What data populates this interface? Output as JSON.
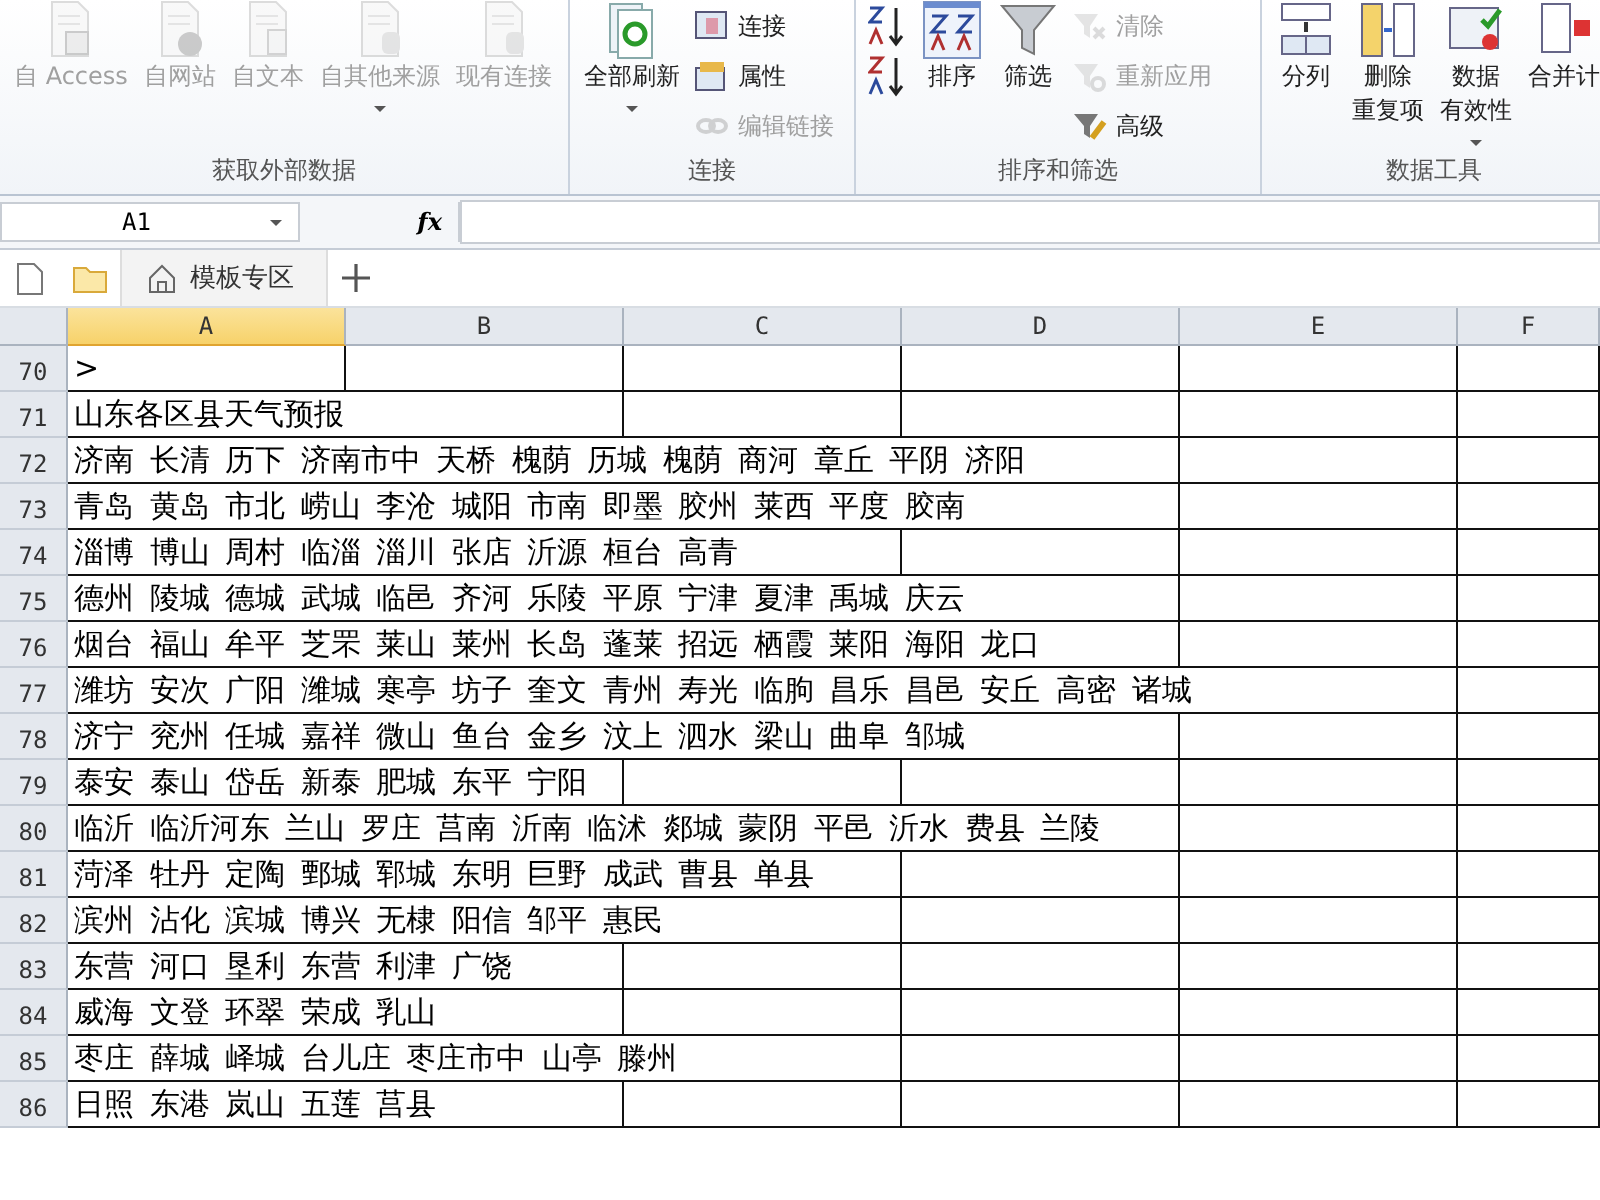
{
  "ribbon": {
    "groups": [
      {
        "label": "获取外部数据",
        "buttons": [
          {
            "lines": [
              "自 Access"
            ],
            "kind": "large",
            "disabled": true,
            "caret": false
          },
          {
            "lines": [
              "自网站"
            ],
            "kind": "large",
            "disabled": true,
            "caret": false
          },
          {
            "lines": [
              "自文本"
            ],
            "kind": "large",
            "disabled": true,
            "caret": false
          },
          {
            "lines": [
              "自其他来源"
            ],
            "kind": "large",
            "disabled": true,
            "caret": true
          },
          {
            "lines": [
              "现有连接"
            ],
            "kind": "large",
            "disabled": true,
            "caret": false
          }
        ]
      },
      {
        "label": "连接",
        "buttons": [
          {
            "lines": [
              "全部刷新"
            ],
            "kind": "large",
            "disabled": false,
            "caret": true
          },
          {
            "lines": [
              "连接"
            ],
            "kind": "small",
            "disabled": false,
            "caret": false
          },
          {
            "lines": [
              "属性"
            ],
            "kind": "small",
            "disabled": false,
            "caret": false
          },
          {
            "lines": [
              "编辑链接"
            ],
            "kind": "small",
            "disabled": true,
            "caret": false
          }
        ]
      },
      {
        "label": "排序和筛选",
        "buttons": [
          {
            "kind": "icon",
            "disabled": false,
            "caret": false
          },
          {
            "kind": "icon",
            "disabled": false,
            "caret": false
          },
          {
            "lines": [
              "排序"
            ],
            "kind": "large",
            "disabled": false,
            "caret": false
          },
          {
            "lines": [
              "筛选"
            ],
            "kind": "large",
            "disabled": false,
            "caret": false
          },
          {
            "lines": [
              "清除"
            ],
            "kind": "small",
            "disabled": true,
            "caret": false
          },
          {
            "lines": [
              "重新应用"
            ],
            "kind": "small",
            "disabled": true,
            "caret": false
          },
          {
            "lines": [
              "高级"
            ],
            "kind": "small",
            "disabled": false,
            "caret": false
          }
        ]
      },
      {
        "label": "数据工具",
        "buttons": [
          {
            "lines": [
              "分列"
            ],
            "kind": "large",
            "disabled": false,
            "caret": false
          },
          {
            "lines": [
              "删除",
              "重复项"
            ],
            "kind": "large",
            "disabled": false,
            "caret": false
          },
          {
            "lines": [
              "数据",
              "有效性"
            ],
            "kind": "large",
            "disabled": false,
            "caret": true
          },
          {
            "lines": [
              "合并计"
            ],
            "kind": "large",
            "disabled": false,
            "caret": false
          }
        ]
      }
    ]
  },
  "name_box": "A1",
  "formula_label": "fx",
  "tabs": [
    {
      "label": "模板专区",
      "selected": true
    }
  ],
  "columns": [
    {
      "label": "A",
      "selected": true
    },
    {
      "label": "B",
      "selected": false
    },
    {
      "label": "C",
      "selected": false
    },
    {
      "label": "D",
      "selected": false
    },
    {
      "label": "E",
      "selected": false
    },
    {
      "label": "F",
      "selected": false
    }
  ],
  "rows": [
    {
      "number": "70",
      "text": ">"
    },
    {
      "number": "71",
      "text": "山东各区县天气预报"
    },
    {
      "number": "72",
      "text": "济南 长清 历下 济南市中 天桥 槐荫 历城 槐荫 商河 章丘 平阴 济阳"
    },
    {
      "number": "73",
      "text": "青岛 黄岛 市北 崂山 李沧 城阳 市南 即墨 胶州 莱西 平度 胶南"
    },
    {
      "number": "74",
      "text": "淄博 博山 周村 临淄 淄川 张店 沂源 桓台 高青"
    },
    {
      "number": "75",
      "text": "德州 陵城 德城 武城 临邑 齐河 乐陵 平原 宁津 夏津 禹城 庆云"
    },
    {
      "number": "76",
      "text": "烟台 福山 牟平 芝罘 莱山 莱州 长岛 蓬莱 招远 栖霞 莱阳 海阳 龙口"
    },
    {
      "number": "77",
      "text": "潍坊 安次 广阳 潍城 寒亭 坊子 奎文 青州 寿光 临朐 昌乐 昌邑 安丘 高密 诸城"
    },
    {
      "number": "78",
      "text": "济宁 兖州 任城 嘉祥 微山 鱼台 金乡 汶上 泗水 梁山 曲阜 邹城"
    },
    {
      "number": "79",
      "text": "泰安 泰山 岱岳 新泰 肥城 东平 宁阳"
    },
    {
      "number": "80",
      "text": "临沂 临沂河东 兰山 罗庄 莒南 沂南 临沭 郯城 蒙阴 平邑 沂水 费县 兰陵"
    },
    {
      "number": "81",
      "text": "菏泽 牡丹 定陶 鄄城 郓城 东明 巨野 成武 曹县 单县"
    },
    {
      "number": "82",
      "text": "滨州 沾化 滨城 博兴 无棣 阳信 邹平 惠民"
    },
    {
      "number": "83",
      "text": "东营 河口 垦利 东营 利津 广饶"
    },
    {
      "number": "84",
      "text": "威海 文登 环翠 荣成 乳山"
    },
    {
      "number": "85",
      "text": "枣庄 薛城 峄城 台儿庄 枣庄市中 山亭 滕州"
    },
    {
      "number": "86",
      "text": "日照 东港 岚山 五莲 莒县"
    }
  ]
}
